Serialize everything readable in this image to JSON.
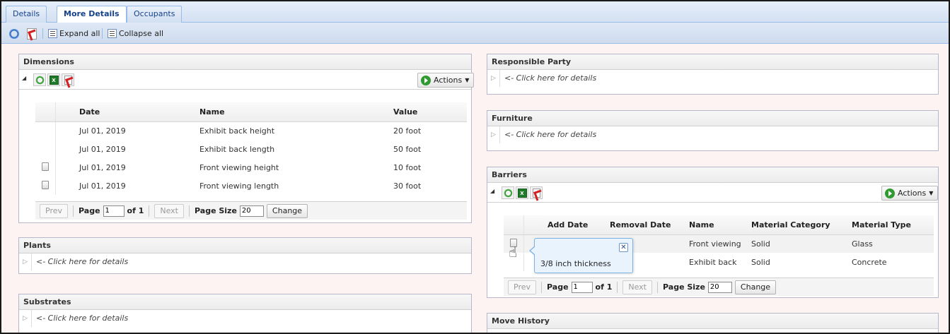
{
  "tabs": [
    {
      "label": "Details",
      "active": false
    },
    {
      "label": "More Details",
      "active": true
    },
    {
      "label": "Occupants",
      "active": false
    }
  ],
  "toolbar": {
    "refresh_icon": "refresh-icon",
    "pdf_icon": "pdf-icon",
    "expand_all": "Expand all",
    "collapse_all": "Collapse all"
  },
  "dimensions": {
    "title": "Dimensions",
    "actions": "Actions",
    "columns": [
      "Date",
      "Name",
      "Value"
    ],
    "rows": [
      {
        "date": "Jul 01, 2019",
        "name": "Exhibit back height",
        "value": "20 foot",
        "has_note": false
      },
      {
        "date": "Jul 01, 2019",
        "name": "Exhibit back length",
        "value": "50 foot",
        "has_note": false
      },
      {
        "date": "Jul 01, 2019",
        "name": "Front viewing height",
        "value": "10 foot",
        "has_note": true
      },
      {
        "date": "Jul 01, 2019",
        "name": "Front viewing length",
        "value": "30 foot",
        "has_note": true
      }
    ],
    "pager": {
      "prev": "Prev",
      "page_label": "Page",
      "page": "1",
      "of": "of 1",
      "next": "Next",
      "size_label": "Page Size",
      "size": "20",
      "change": "Change"
    }
  },
  "plants": {
    "title": "Plants",
    "hint": "<- Click here for details"
  },
  "substrates": {
    "title": "Substrates",
    "hint": "<- Click here for details"
  },
  "responsible_party": {
    "title": "Responsible Party",
    "hint": "<- Click here for details"
  },
  "furniture": {
    "title": "Furniture",
    "hint": "<- Click here for details"
  },
  "barriers": {
    "title": "Barriers",
    "actions": "Actions",
    "columns": [
      "Add Date",
      "Removal Date",
      "Name",
      "Material Category",
      "Material Type"
    ],
    "rows": [
      {
        "add_date": "",
        "removal_date": "",
        "name": "Front viewing",
        "category": "Solid",
        "type": "Glass"
      },
      {
        "add_date": "",
        "removal_date": "",
        "name": "Exhibit back",
        "category": "Solid",
        "type": "Concrete"
      }
    ],
    "tooltip": "3/8 inch thickness",
    "pager": {
      "prev": "Prev",
      "page_label": "Page",
      "page": "1",
      "of": "of 1",
      "next": "Next",
      "size_label": "Page Size",
      "size": "20",
      "change": "Change"
    }
  },
  "move_history": {
    "title": "Move History"
  },
  "colors": {
    "tab_blue": "#15428b",
    "panel_bg": "#fdf3f3",
    "toolbar_border": "#99bbe8",
    "tooltip_bg": "#e9f3fe"
  }
}
